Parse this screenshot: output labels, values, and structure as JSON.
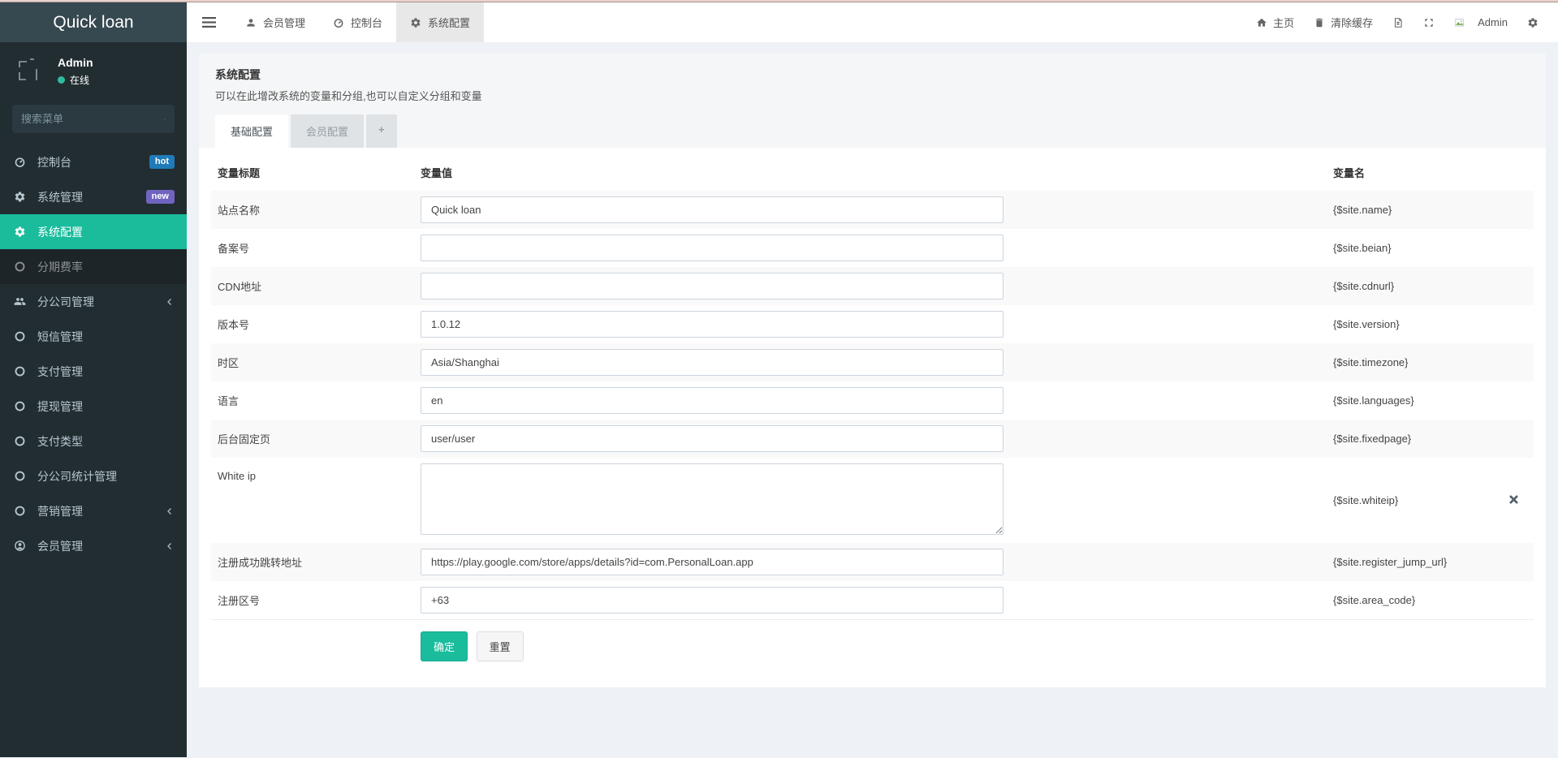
{
  "app": {
    "title": "Quick loan"
  },
  "sidebar": {
    "user": {
      "name": "Admin",
      "status": "在线"
    },
    "search_placeholder": "搜索菜单",
    "items": [
      {
        "label": "控制台",
        "badge": "hot"
      },
      {
        "label": "系统管理",
        "badge": "new"
      },
      {
        "label": "系统配置"
      },
      {
        "label": "分期费率"
      },
      {
        "label": "分公司管理"
      },
      {
        "label": "短信管理"
      },
      {
        "label": "支付管理"
      },
      {
        "label": "提现管理"
      },
      {
        "label": "支付类型"
      },
      {
        "label": "分公司统计管理"
      },
      {
        "label": "营销管理"
      },
      {
        "label": "会员管理"
      }
    ]
  },
  "topnav": {
    "tabs": [
      {
        "label": "会员管理"
      },
      {
        "label": "控制台"
      },
      {
        "label": "系统配置"
      }
    ],
    "right": {
      "home": "主页",
      "clear_cache": "清除缓存",
      "username": "Admin"
    }
  },
  "panel": {
    "title": "系统配置",
    "description": "可以在此增改系统的变量和分组,也可以自定义分组和变量",
    "tabs": [
      {
        "label": "基础配置"
      },
      {
        "label": "会员配置"
      },
      {
        "label": "+"
      }
    ]
  },
  "form": {
    "headers": {
      "title": "变量标题",
      "value": "变量值",
      "name": "变量名"
    },
    "rows": [
      {
        "label": "站点名称",
        "value": "Quick loan",
        "var": "{$site.name}"
      },
      {
        "label": "备案号",
        "value": "",
        "var": "{$site.beian}"
      },
      {
        "label": "CDN地址",
        "value": "",
        "var": "{$site.cdnurl}"
      },
      {
        "label": "版本号",
        "value": "1.0.12",
        "var": "{$site.version}"
      },
      {
        "label": "时区",
        "value": "Asia/Shanghai",
        "var": "{$site.timezone}"
      },
      {
        "label": "语言",
        "value": "en",
        "var": "{$site.languages}"
      },
      {
        "label": "后台固定页",
        "value": "user/user",
        "var": "{$site.fixedpage}"
      },
      {
        "label": "White ip",
        "value": "",
        "var": "{$site.whiteip}"
      },
      {
        "label": "注册成功跳转地址",
        "value": "https://play.google.com/store/apps/details?id=com.PersonalLoan.app",
        "var": "{$site.register_jump_url}"
      },
      {
        "label": "注册区号",
        "value": "+63",
        "var": "{$site.area_code}"
      }
    ],
    "buttons": {
      "submit": "确定",
      "reset": "重置"
    }
  },
  "colors": {
    "accent": "#1abc9c",
    "badge_hot": "#1f7bb8",
    "badge_new": "#7064c0",
    "sidebar_bg": "#222d32"
  }
}
